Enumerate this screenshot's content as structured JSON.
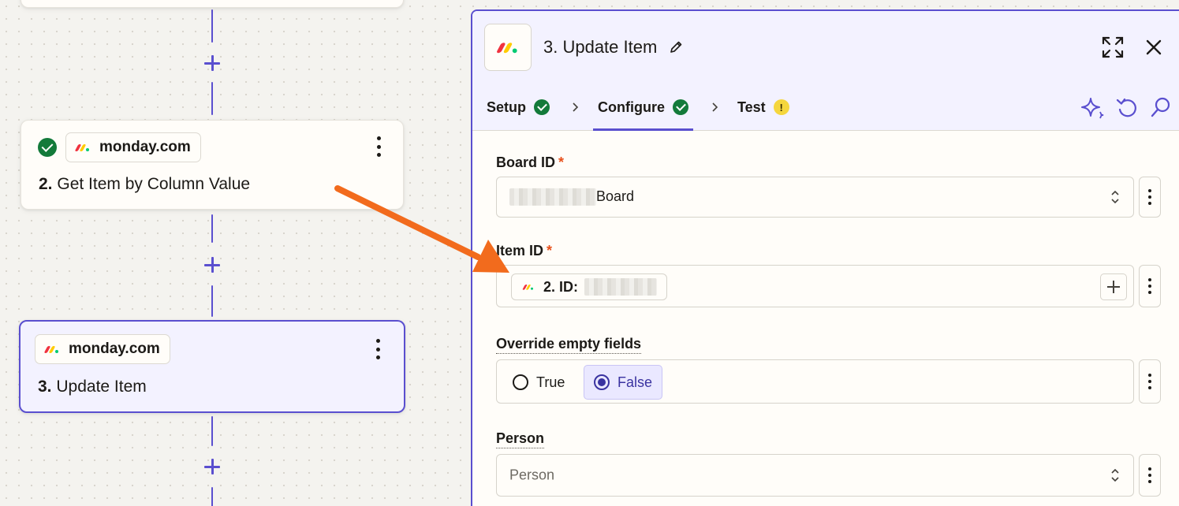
{
  "canvas": {
    "step2": {
      "app": "monday.com",
      "number": "2.",
      "title": "Get Item by Column Value"
    },
    "step3": {
      "app": "monday.com",
      "number": "3.",
      "title": "Update Item"
    }
  },
  "panel": {
    "title": "3. Update Item",
    "tabs": [
      {
        "label": "Setup",
        "status": "complete"
      },
      {
        "label": "Configure",
        "status": "complete"
      },
      {
        "label": "Test",
        "status": "warning",
        "status_glyph": "!"
      }
    ],
    "fields": {
      "board": {
        "label": "Board ID",
        "required": "*",
        "value_suffix": "Board"
      },
      "item": {
        "label": "Item ID",
        "required": "*",
        "pill_text": "2. ID:"
      },
      "override": {
        "label": "Override empty fields",
        "options": [
          "True",
          "False"
        ],
        "selected": "False"
      },
      "person": {
        "label": "Person",
        "placeholder": "Person"
      }
    }
  },
  "colors": {
    "accent": "#5a4fcf",
    "success": "#137a3a",
    "warning": "#f5d63d",
    "annotation_arrow": "#f26b1d"
  },
  "icons": [
    "monday-logo-icon",
    "pencil-icon",
    "expand-icon",
    "close-icon",
    "check-icon",
    "chevron-right-icon",
    "sparkle-icon",
    "undo-icon",
    "search-icon",
    "updown-icon",
    "kebab-icon",
    "plus-icon"
  ]
}
